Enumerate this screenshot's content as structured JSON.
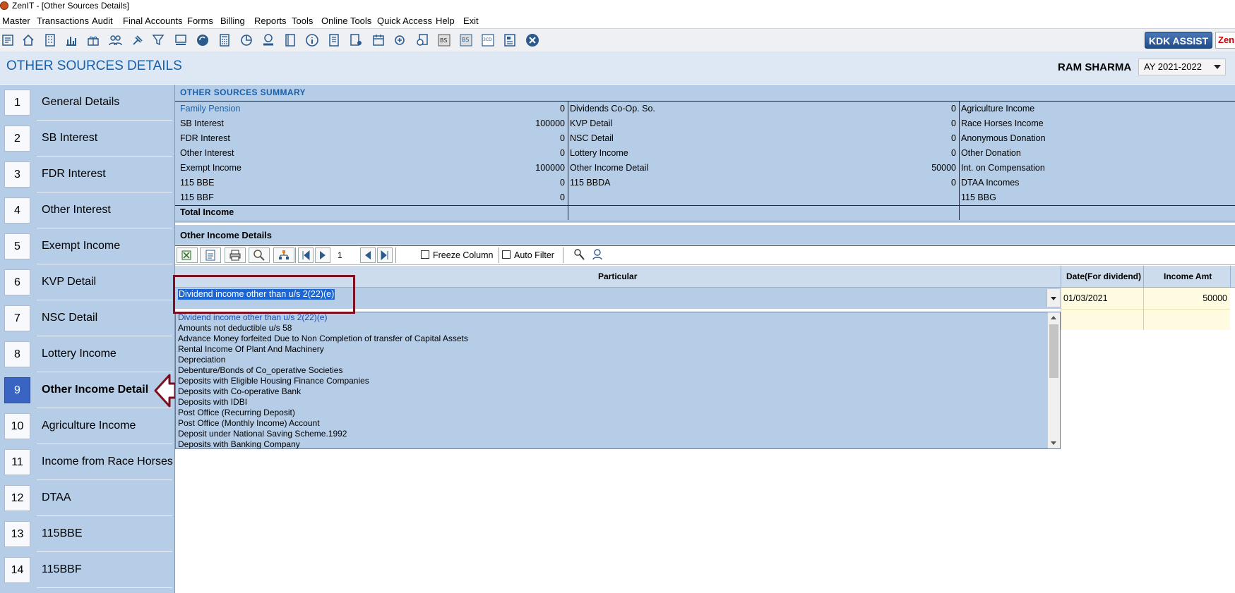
{
  "window": {
    "title": "ZenIT - [Other Sources Details]"
  },
  "menu": [
    "Master",
    "Transactions",
    "Audit",
    "Final Accounts",
    "Forms",
    "Billing",
    "Reports",
    "Tools",
    "Online Tools",
    "Quick Access",
    "Help",
    "Exit"
  ],
  "toolbar": {
    "icons": [
      "report-icon",
      "home-icon",
      "building-icon",
      "bar-chart-icon",
      "gift-icon",
      "users-icon",
      "gavel-icon",
      "filter-icon",
      "tax-icon",
      "refresh-icon",
      "calculator-icon",
      "pie-chart-icon",
      "pay-icon",
      "book-icon",
      "info-icon",
      "form-icon",
      "user-doc-icon",
      "calendar-icon",
      "add-icon",
      "search-doc-icon",
      "balance-sheet-icon",
      "balance-sheet-new-icon",
      "form-3cd-icon",
      "news-icon",
      "close-circle-icon"
    ],
    "kdk_label": "KDK ASSIST",
    "zen_label": "Zen I"
  },
  "header": {
    "page_title": "OTHER SOURCES DETAILS",
    "user_name": "RAM SHARMA",
    "assessment_year": "AY 2021-2022"
  },
  "sidebar": {
    "items": [
      {
        "num": "1",
        "label": "General Details"
      },
      {
        "num": "2",
        "label": "SB Interest"
      },
      {
        "num": "3",
        "label": "FDR Interest"
      },
      {
        "num": "4",
        "label": "Other Interest"
      },
      {
        "num": "5",
        "label": "Exempt Income"
      },
      {
        "num": "6",
        "label": "KVP Detail"
      },
      {
        "num": "7",
        "label": "NSC Detail"
      },
      {
        "num": "8",
        "label": "Lottery Income"
      },
      {
        "num": "9",
        "label": "Other Income Detail"
      },
      {
        "num": "10",
        "label": "Agriculture Income"
      },
      {
        "num": "11",
        "label": "Income from Race Horses"
      },
      {
        "num": "12",
        "label": "DTAA"
      },
      {
        "num": "13",
        "label": "115BBE"
      },
      {
        "num": "14",
        "label": "115BBF"
      }
    ],
    "active_index": 8
  },
  "summary": {
    "title": "OTHER SOURCES SUMMARY",
    "col1": [
      {
        "label": "Family Pension",
        "value": "0"
      },
      {
        "label": "SB Interest",
        "value": "100000"
      },
      {
        "label": "FDR Interest",
        "value": "0"
      },
      {
        "label": "Other Interest",
        "value": "0"
      },
      {
        "label": "Exempt Income",
        "value": "100000"
      },
      {
        "label": "115 BBE",
        "value": "0"
      },
      {
        "label": "115 BBF",
        "value": "0"
      }
    ],
    "col2": [
      {
        "label": "Dividends Co-Op. So.",
        "value": "0"
      },
      {
        "label": "KVP Detail",
        "value": "0"
      },
      {
        "label": "NSC Detail",
        "value": "0"
      },
      {
        "label": "Lottery Income",
        "value": "0"
      },
      {
        "label": "Other Income Detail",
        "value": "50000"
      },
      {
        "label": "115 BBDA",
        "value": "0"
      }
    ],
    "col3": [
      {
        "label": "Agriculture Income"
      },
      {
        "label": "Race Horses Income"
      },
      {
        "label": "Anonymous Donation"
      },
      {
        "label": "Other Donation"
      },
      {
        "label": "Int. on Compensation"
      },
      {
        "label": "DTAA Incomes"
      },
      {
        "label": "115 BBG"
      }
    ],
    "total_label": "Total Income"
  },
  "other_income": {
    "section_title": "Other Income Details",
    "page_number": "1",
    "freeze_column": "Freeze Column",
    "auto_filter": "Auto Filter",
    "columns": {
      "particular": "Particular",
      "date": "Date(For dividend)",
      "amount": "Income Amt"
    },
    "row": {
      "particular": "Dividend income other than u/s 2(22)(e)",
      "date": "01/03/2021",
      "amount": "50000"
    },
    "dropdown_items": [
      "Dividend income other than u/s 2(22)(e)",
      "Amounts not deductible u/s 58",
      "Advance Money forfeited Due to Non Completion of transfer of Capital Assets",
      "Rental Income Of Plant And Machinery",
      "Depreciation",
      "Debenture/Bonds of Co_operative Societies",
      "Deposits with Eligible Housing Finance Companies",
      "Deposits with Co-operative Bank",
      "Deposits with IDBI",
      "Post Office (Recurring Deposit)",
      "Post Office (Monthly Income) Account",
      "Deposit under National Saving Scheme.1992",
      "Deposits with Banking Company"
    ]
  },
  "colors": {
    "accent": "#1a5fa8",
    "panel": "#b5cde6",
    "active_item": "#3a64c2",
    "highlight_box": "#7c1020",
    "selection": "#1a66d4"
  }
}
